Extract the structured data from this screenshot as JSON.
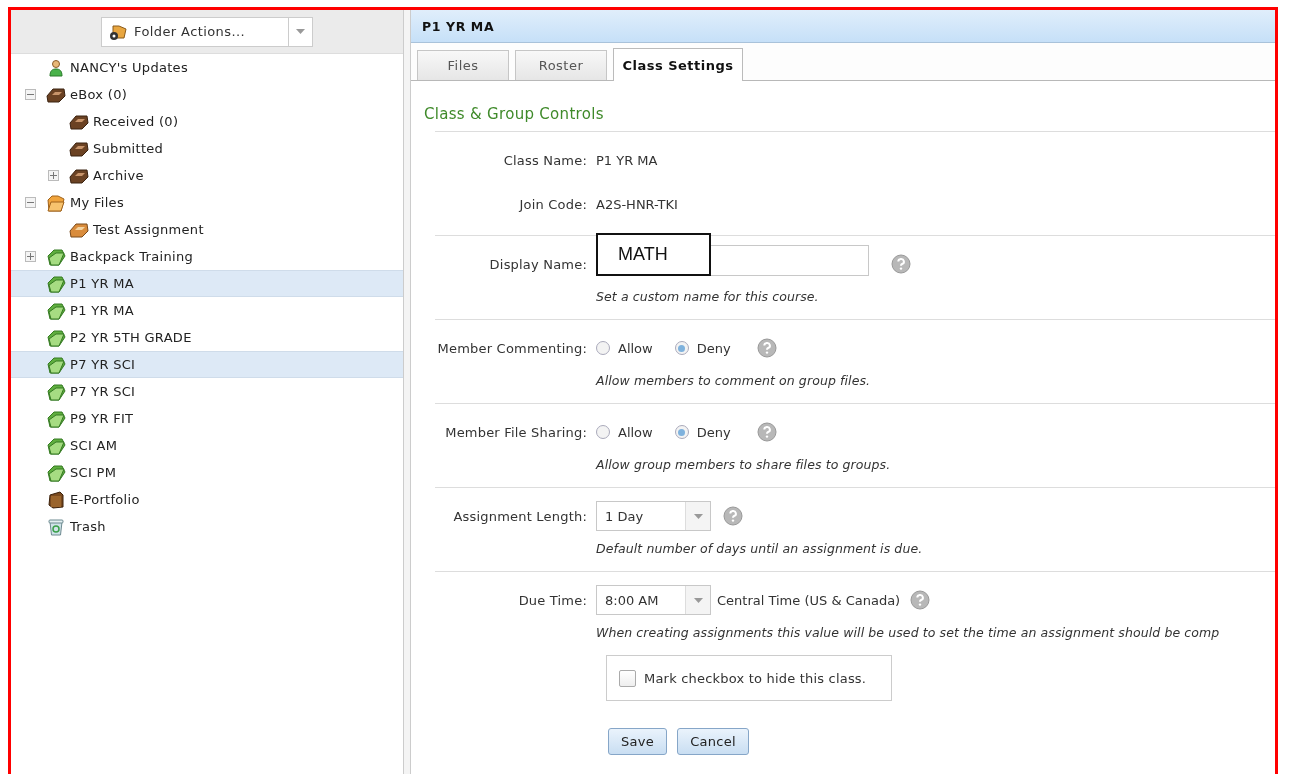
{
  "sidebar": {
    "folder_actions": {
      "label": "Folder Actions..."
    },
    "tree": [
      {
        "label": "NANCY's Updates",
        "kind": "user",
        "selected": false
      },
      {
        "label": "eBox (0)",
        "kind": "tray",
        "selected": false,
        "expanded": true,
        "children": [
          {
            "label": "Received (0)",
            "kind": "tray",
            "selected": false
          },
          {
            "label": "Submitted",
            "kind": "tray",
            "selected": false
          },
          {
            "label": "Archive",
            "kind": "tray",
            "selected": false,
            "expanded": false
          }
        ]
      },
      {
        "label": "My Files",
        "kind": "folder",
        "selected": false,
        "expanded": true,
        "children": [
          {
            "label": "Test Assignment",
            "kind": "assignment",
            "selected": false
          }
        ]
      },
      {
        "label": "Backpack Training",
        "kind": "class",
        "selected": false,
        "expanded": false
      },
      {
        "label": "P1 YR MA",
        "kind": "class",
        "selected": true
      },
      {
        "label": "P1 YR MA",
        "kind": "class",
        "selected": false
      },
      {
        "label": "P2 YR 5TH GRADE",
        "kind": "class",
        "selected": false
      },
      {
        "label": "P7 YR SCI",
        "kind": "class",
        "selected": true
      },
      {
        "label": "P7 YR SCI",
        "kind": "class",
        "selected": false
      },
      {
        "label": "P9 YR FIT",
        "kind": "class",
        "selected": false
      },
      {
        "label": "SCI AM",
        "kind": "class",
        "selected": false
      },
      {
        "label": "SCI PM",
        "kind": "class",
        "selected": false
      },
      {
        "label": "E-Portfolio",
        "kind": "portfolio",
        "selected": false
      },
      {
        "label": "Trash",
        "kind": "trash",
        "selected": false
      }
    ]
  },
  "panel": {
    "title": "P1 YR MA",
    "tabs": [
      {
        "label": "Files",
        "selected": false
      },
      {
        "label": "Roster",
        "selected": false
      },
      {
        "label": "Class Settings",
        "selected": true
      }
    ],
    "section_title": "Class & Group Controls",
    "groups": [
      {
        "fields": [
          {
            "kind": "text",
            "label": "Class Name:",
            "value": "P1 YR MA"
          },
          {
            "kind": "text",
            "label": "Join Code:",
            "value": "A2S-HNR-TKI"
          }
        ]
      },
      {
        "fields": [
          {
            "kind": "input",
            "label": "Display Name:",
            "value": "MATH",
            "help": true,
            "hint": "Set a custom name for this course."
          }
        ]
      },
      {
        "fields": [
          {
            "kind": "radio",
            "label": "Member Commenting:",
            "options": [
              {
                "label": "Allow",
                "selected": false
              },
              {
                "label": "Deny",
                "selected": true
              }
            ],
            "help": true,
            "hint": "Allow members to comment on group files."
          }
        ]
      },
      {
        "fields": [
          {
            "kind": "radio",
            "label": "Member File Sharing:",
            "options": [
              {
                "label": "Allow",
                "selected": false
              },
              {
                "label": "Deny",
                "selected": true
              }
            ],
            "help": true,
            "hint": "Allow group members to share files to groups."
          }
        ]
      },
      {
        "fields": [
          {
            "kind": "select",
            "label": "Assignment Length:",
            "value": "1 Day",
            "help": true,
            "hint": "Default number of days until an assignment is due."
          }
        ]
      },
      {
        "fields": [
          {
            "kind": "select",
            "label": "Due Time:",
            "value": "8:00 AM",
            "suffix": "Central Time (US & Canada)",
            "help": true,
            "hint": "When creating assignments this value will be used to set the time an assignment should be comp"
          }
        ]
      }
    ],
    "checkbox": {
      "label": "Mark checkbox to hide this class.",
      "checked": false
    },
    "buttons": [
      "Save",
      "Cancel"
    ]
  }
}
